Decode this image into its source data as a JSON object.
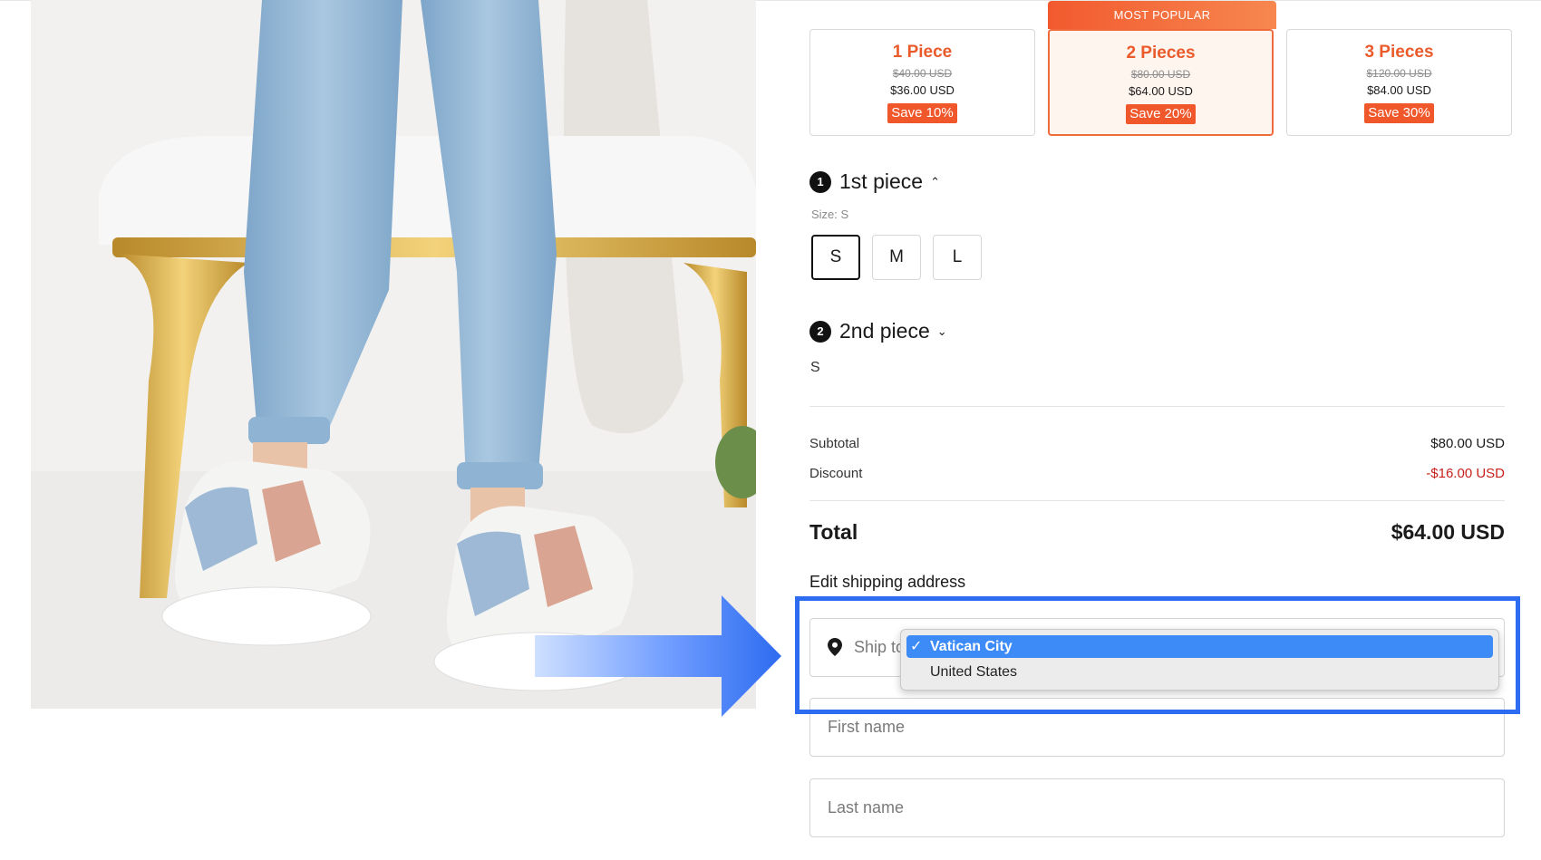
{
  "bundles": [
    {
      "title": "1 Piece",
      "original_price": "$40.00 USD",
      "price": "$36.00 USD",
      "save": "Save 10%"
    },
    {
      "title": "2 Pieces",
      "original_price": "$80.00 USD",
      "price": "$64.00 USD",
      "save": "Save 20%",
      "badge": "MOST POPULAR"
    },
    {
      "title": "3 Pieces",
      "original_price": "$120.00 USD",
      "price": "$84.00 USD",
      "save": "Save 30%"
    }
  ],
  "first_piece": {
    "number": "1",
    "label": "1st piece",
    "size_caption": "Size: S",
    "sizes": [
      "S",
      "M",
      "L"
    ]
  },
  "second_piece": {
    "number": "2",
    "label": "2nd piece",
    "value": "S"
  },
  "summary": {
    "subtotal_label": "Subtotal",
    "subtotal": "$80.00 USD",
    "discount_label": "Discount",
    "discount": "-$16.00 USD",
    "total_label": "Total",
    "total": "$64.00 USD"
  },
  "shipping": {
    "title": "Edit shipping address",
    "ship_to_placeholder": "Ship to",
    "country_options": [
      "Vatican City",
      "United States"
    ],
    "first_name_placeholder": "First name",
    "last_name_placeholder": "Last name"
  },
  "colors": {
    "accent": "#f0582c",
    "highlight": "#2d6cf0",
    "discount": "#c8201c"
  }
}
